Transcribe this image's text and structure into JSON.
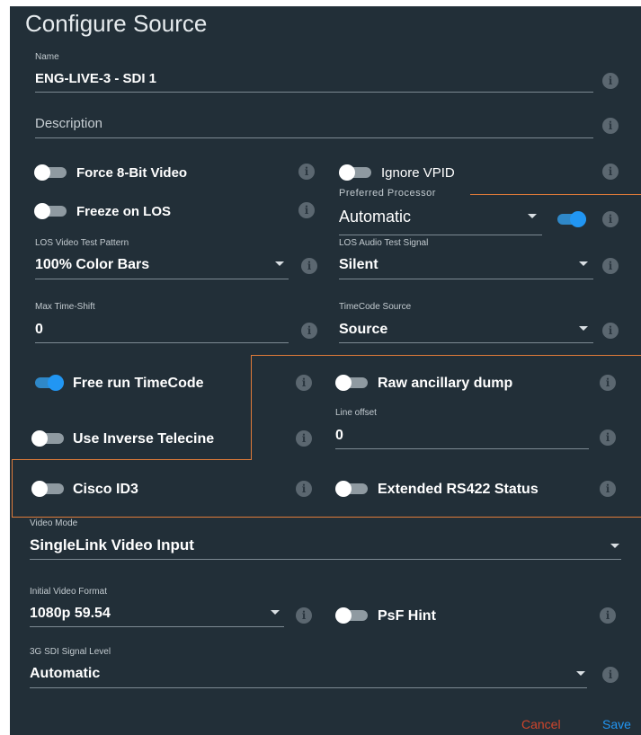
{
  "dialog": {
    "title": "Configure Source",
    "name": {
      "label": "Name",
      "value": "ENG-LIVE-3 - SDI 1"
    },
    "description": {
      "placeholder": "Description"
    },
    "force_8bit": {
      "label": "Force 8-Bit Video",
      "on": false
    },
    "ignore_vpid": {
      "label": "Ignore VPID",
      "on": false
    },
    "freeze_on_los": {
      "label": "Freeze on LOS",
      "on": false
    },
    "preferred_processor": {
      "label": "Preferred Processor",
      "value": "Automatic",
      "toggle_on": true
    },
    "los_video_test_pattern": {
      "label": "LOS Video Test Pattern",
      "value": "100% Color Bars"
    },
    "los_audio_test_signal": {
      "label": "LOS Audio Test Signal",
      "value": "Silent"
    },
    "max_time_shift": {
      "label": "Max Time-Shift",
      "value": "0"
    },
    "timecode_source": {
      "label": "TimeCode Source",
      "value": "Source"
    },
    "free_run_timecode": {
      "label": "Free run TimeCode",
      "on": true
    },
    "raw_ancillary_dump": {
      "label": "Raw ancillary dump",
      "on": false
    },
    "line_offset": {
      "label": "Line offset",
      "value": "0"
    },
    "use_inverse_telecine": {
      "label": "Use Inverse Telecine",
      "on": false
    },
    "cisco_id3": {
      "label": "Cisco ID3",
      "on": false
    },
    "extended_rs422_status": {
      "label": "Extended RS422 Status",
      "on": false
    },
    "video_mode": {
      "label": "Video Mode",
      "value": "SingleLink Video Input"
    },
    "initial_video_format": {
      "label": "Initial Video Format",
      "value": "1080p 59.54"
    },
    "psf_hint": {
      "label": "PsF Hint",
      "on": false
    },
    "sdi_signal_level": {
      "label": "3G SDI Signal Level",
      "value": "Automatic"
    },
    "actions": {
      "cancel": "Cancel",
      "save": "Save"
    }
  },
  "icons": {
    "info": "info-icon",
    "dropdown": "dropdown-caret-icon"
  },
  "colors": {
    "background": "#222f38",
    "toggle_on": "#2196f3",
    "cancel": "#d0452b",
    "save": "#2196f3",
    "highlight_outline": "#e07b39"
  }
}
